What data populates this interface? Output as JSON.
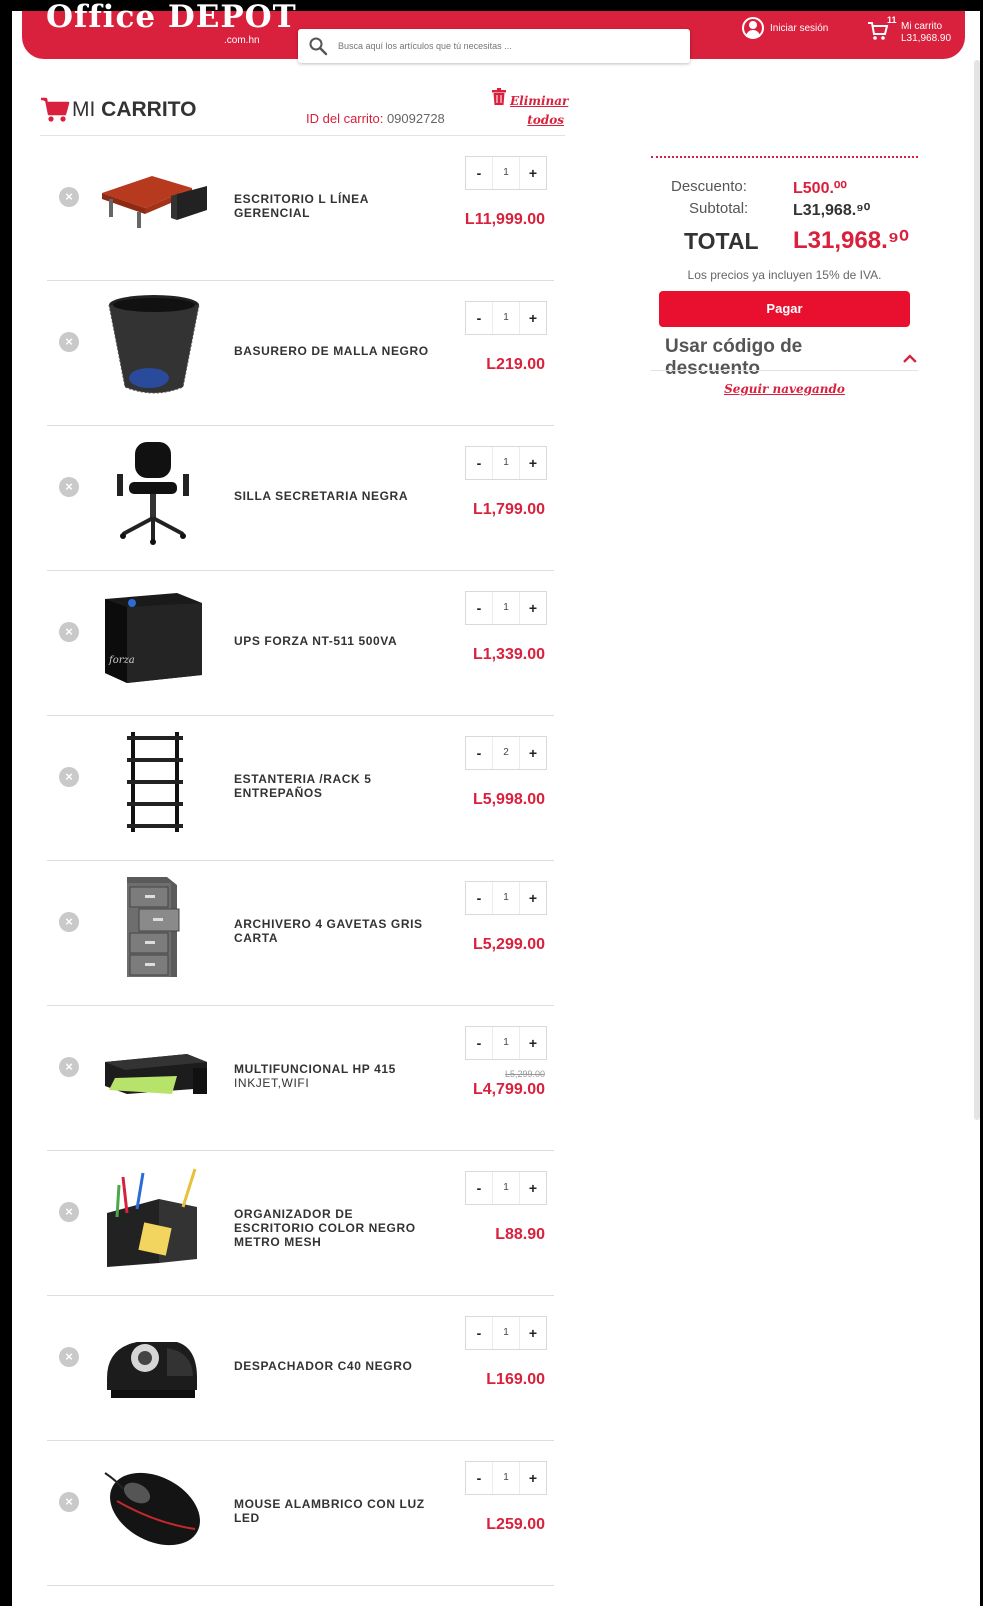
{
  "header": {
    "logo": "Office DEPOT",
    "logo_sub": ".com.hn",
    "search_placeholder": "Busca aquí los artículos que tú necesitas ...",
    "login_label": "Iniciar sesión",
    "cart_count": "11",
    "cart_label": "Mi carrito",
    "cart_total": "L31,968.90",
    "brand_color": "#d9203c"
  },
  "cart": {
    "title_prefix": "MI",
    "title_main": "CARRITO",
    "id_label": "ID del carrito:",
    "id_value": "09092728",
    "delete_all": "Eliminar todos"
  },
  "items": [
    {
      "name": "ESCRITORIO L LÍNEA GERENCIAL",
      "sub": "",
      "qty": "1",
      "price": "L11,999.00",
      "old_price": "",
      "icon": "desk-image"
    },
    {
      "name": "BASURERO DE MALLA NEGRO",
      "sub": "",
      "qty": "1",
      "price": "L219.00",
      "old_price": "",
      "icon": "trash-bin-image"
    },
    {
      "name": "SILLA SECRETARIA NEGRA",
      "sub": "",
      "qty": "1",
      "price": "L1,799.00",
      "old_price": "",
      "icon": "chair-image"
    },
    {
      "name": "UPS FORZA NT-511 500VA",
      "sub": "",
      "qty": "1",
      "price": "L1,339.00",
      "old_price": "",
      "icon": "ups-image"
    },
    {
      "name": "ESTANTERIA /RACK 5 ENTREPAÑOS",
      "sub": "",
      "qty": "2",
      "price": "L5,998.00",
      "old_price": "",
      "icon": "shelf-image"
    },
    {
      "name": "ARCHIVERO 4 GAVETAS GRIS CARTA",
      "sub": "",
      "qty": "1",
      "price": "L5,299.00",
      "old_price": "",
      "icon": "file-cabinet-image"
    },
    {
      "name": "MULTIFUNCIONAL HP 415",
      "sub": "INKJET,WIFI",
      "qty": "1",
      "price": "L4,799.00",
      "old_price": "L5,299.00",
      "icon": "printer-image"
    },
    {
      "name": "ORGANIZADOR DE ESCRITORIO COLOR NEGRO METRO MESH",
      "sub": "",
      "qty": "1",
      "price": "L88.90",
      "old_price": "",
      "icon": "organizer-image"
    },
    {
      "name": "DESPACHADOR C40 NEGRO",
      "sub": "",
      "qty": "1",
      "price": "L169.00",
      "old_price": "",
      "icon": "tape-dispenser-image"
    },
    {
      "name": "MOUSE ALAMBRICO CON LUZ LED",
      "sub": "",
      "qty": "1",
      "price": "L259.00",
      "old_price": "",
      "icon": "mouse-image"
    }
  ],
  "qty_minus": "-",
  "qty_plus": "+",
  "remove_symbol": "×",
  "summary": {
    "discount_label": "Descuento:",
    "discount_value": "L500.⁰⁰",
    "subtotal_label": "Subtotal:",
    "subtotal_value": "L31,968.⁹⁰",
    "total_label": "TOTAL",
    "total_value": "L31,968.⁹⁰",
    "iva_note": "Los precios ya incluyen 15% de IVA.",
    "pay_button": "Pagar",
    "discount_code": "Usar código de descuento",
    "keep_browsing": "Seguir navegando"
  }
}
